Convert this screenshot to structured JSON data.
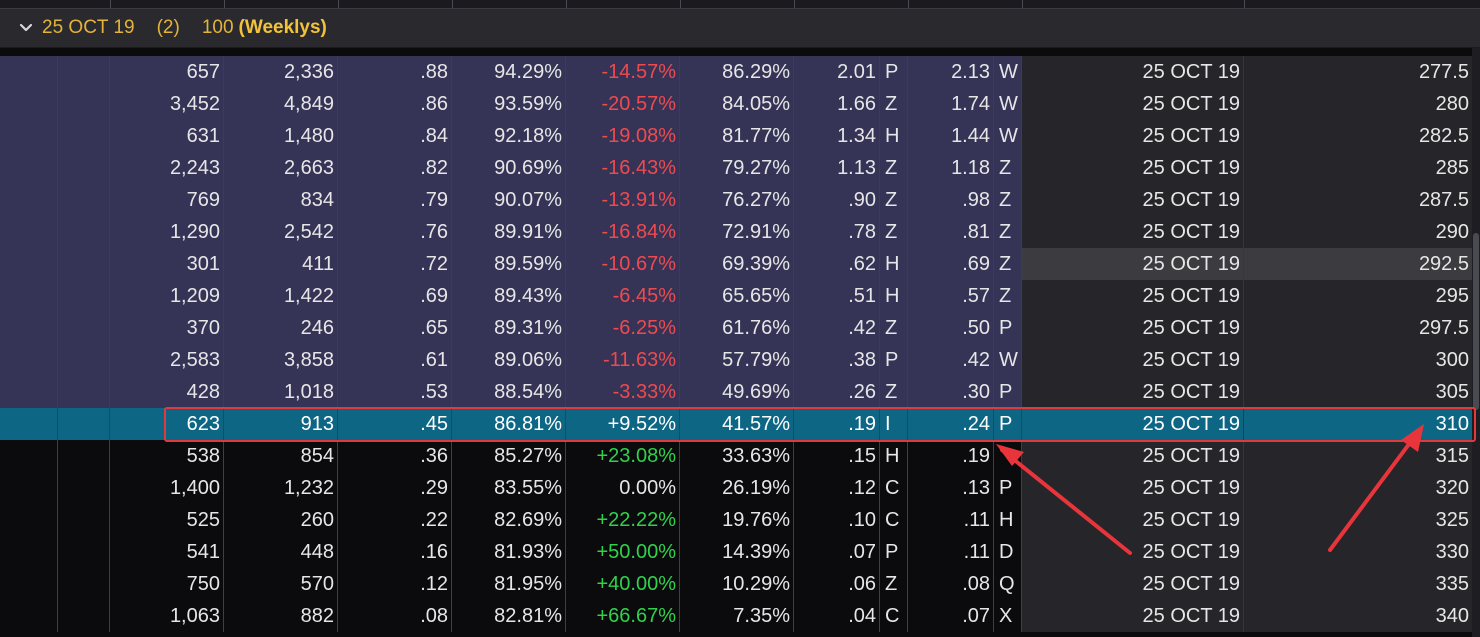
{
  "group": {
    "date": "25 OCT 19",
    "count": "(2)",
    "multiplier": "100",
    "series": "(Weeklys)",
    "chevron_icon": "chevron-down-icon",
    "accent_color": "#e3b437"
  },
  "selected_row_index": 11,
  "highlighted_row_index": 6,
  "scroll": {
    "position_fraction": 0.45,
    "visible_fraction": 0.3
  },
  "rows": [
    {
      "c1": "657",
      "c2": "2,336",
      "c3": ".88",
      "c4": "94.29%",
      "c5": "-14.57%",
      "c6": "86.29%",
      "bid": "2.01",
      "bx": "P",
      "ask": "2.13",
      "ax": "W",
      "exp": "25 OCT 19",
      "strike": "277.5",
      "itm": true
    },
    {
      "c1": "3,452",
      "c2": "4,849",
      "c3": ".86",
      "c4": "93.59%",
      "c5": "-20.57%",
      "c6": "84.05%",
      "bid": "1.66",
      "bx": "Z",
      "ask": "1.74",
      "ax": "W",
      "exp": "25 OCT 19",
      "strike": "280",
      "itm": true
    },
    {
      "c1": "631",
      "c2": "1,480",
      "c3": ".84",
      "c4": "92.18%",
      "c5": "-19.08%",
      "c6": "81.77%",
      "bid": "1.34",
      "bx": "H",
      "ask": "1.44",
      "ax": "W",
      "exp": "25 OCT 19",
      "strike": "282.5",
      "itm": true
    },
    {
      "c1": "2,243",
      "c2": "2,663",
      "c3": ".82",
      "c4": "90.69%",
      "c5": "-16.43%",
      "c6": "79.27%",
      "bid": "1.13",
      "bx": "Z",
      "ask": "1.18",
      "ax": "Z",
      "exp": "25 OCT 19",
      "strike": "285",
      "itm": true
    },
    {
      "c1": "769",
      "c2": "834",
      "c3": ".79",
      "c4": "90.07%",
      "c5": "-13.91%",
      "c6": "76.27%",
      "bid": ".90",
      "bx": "Z",
      "ask": ".98",
      "ax": "Z",
      "exp": "25 OCT 19",
      "strike": "287.5",
      "itm": true
    },
    {
      "c1": "1,290",
      "c2": "2,542",
      "c3": ".76",
      "c4": "89.91%",
      "c5": "-16.84%",
      "c6": "72.91%",
      "bid": ".78",
      "bx": "Z",
      "ask": ".81",
      "ax": "Z",
      "exp": "25 OCT 19",
      "strike": "290",
      "itm": true
    },
    {
      "c1": "301",
      "c2": "411",
      "c3": ".72",
      "c4": "89.59%",
      "c5": "-10.67%",
      "c6": "69.39%",
      "bid": ".62",
      "bx": "H",
      "ask": ".69",
      "ax": "Z",
      "exp": "25 OCT 19",
      "strike": "292.5",
      "itm": true
    },
    {
      "c1": "1,209",
      "c2": "1,422",
      "c3": ".69",
      "c4": "89.43%",
      "c5": "-6.45%",
      "c6": "65.65%",
      "bid": ".51",
      "bx": "H",
      "ask": ".57",
      "ax": "Z",
      "exp": "25 OCT 19",
      "strike": "295",
      "itm": true
    },
    {
      "c1": "370",
      "c2": "246",
      "c3": ".65",
      "c4": "89.31%",
      "c5": "-6.25%",
      "c6": "61.76%",
      "bid": ".42",
      "bx": "Z",
      "ask": ".50",
      "ax": "P",
      "exp": "25 OCT 19",
      "strike": "297.5",
      "itm": true
    },
    {
      "c1": "2,583",
      "c2": "3,858",
      "c3": ".61",
      "c4": "89.06%",
      "c5": "-11.63%",
      "c6": "57.79%",
      "bid": ".38",
      "bx": "P",
      "ask": ".42",
      "ax": "W",
      "exp": "25 OCT 19",
      "strike": "300",
      "itm": true
    },
    {
      "c1": "428",
      "c2": "1,018",
      "c3": ".53",
      "c4": "88.54%",
      "c5": "-3.33%",
      "c6": "49.69%",
      "bid": ".26",
      "bx": "Z",
      "ask": ".30",
      "ax": "P",
      "exp": "25 OCT 19",
      "strike": "305",
      "itm": true
    },
    {
      "c1": "623",
      "c2": "913",
      "c3": ".45",
      "c4": "86.81%",
      "c5": "+9.52%",
      "c6": "41.57%",
      "bid": ".19",
      "bx": "I",
      "ask": ".24",
      "ax": "P",
      "exp": "25 OCT 19",
      "strike": "310",
      "itm": false
    },
    {
      "c1": "538",
      "c2": "854",
      "c3": ".36",
      "c4": "85.27%",
      "c5": "+23.08%",
      "c6": "33.63%",
      "bid": ".15",
      "bx": "H",
      "ask": ".19",
      "ax": "",
      "exp": "25 OCT 19",
      "strike": "315",
      "itm": false
    },
    {
      "c1": "1,400",
      "c2": "1,232",
      "c3": ".29",
      "c4": "83.55%",
      "c5": "0.00%",
      "c6": "26.19%",
      "bid": ".12",
      "bx": "C",
      "ask": ".13",
      "ax": "P",
      "exp": "25 OCT 19",
      "strike": "320",
      "itm": false
    },
    {
      "c1": "525",
      "c2": "260",
      "c3": ".22",
      "c4": "82.69%",
      "c5": "+22.22%",
      "c6": "19.76%",
      "bid": ".10",
      "bx": "C",
      "ask": ".11",
      "ax": "H",
      "exp": "25 OCT 19",
      "strike": "325",
      "itm": false
    },
    {
      "c1": "541",
      "c2": "448",
      "c3": ".16",
      "c4": "81.93%",
      "c5": "+50.00%",
      "c6": "14.39%",
      "bid": ".07",
      "bx": "P",
      "ask": ".11",
      "ax": "D",
      "exp": "25 OCT 19",
      "strike": "330",
      "itm": false
    },
    {
      "c1": "750",
      "c2": "570",
      "c3": ".12",
      "c4": "81.95%",
      "c5": "+40.00%",
      "c6": "10.29%",
      "bid": ".06",
      "bx": "Z",
      "ask": ".08",
      "ax": "Q",
      "exp": "25 OCT 19",
      "strike": "335",
      "itm": false
    },
    {
      "c1": "1,063",
      "c2": "882",
      "c3": ".08",
      "c4": "82.81%",
      "c5": "+66.67%",
      "c6": "7.35%",
      "bid": ".04",
      "bx": "C",
      "ask": ".07",
      "ax": "X",
      "exp": "25 OCT 19",
      "strike": "340",
      "itm": false
    }
  ]
}
